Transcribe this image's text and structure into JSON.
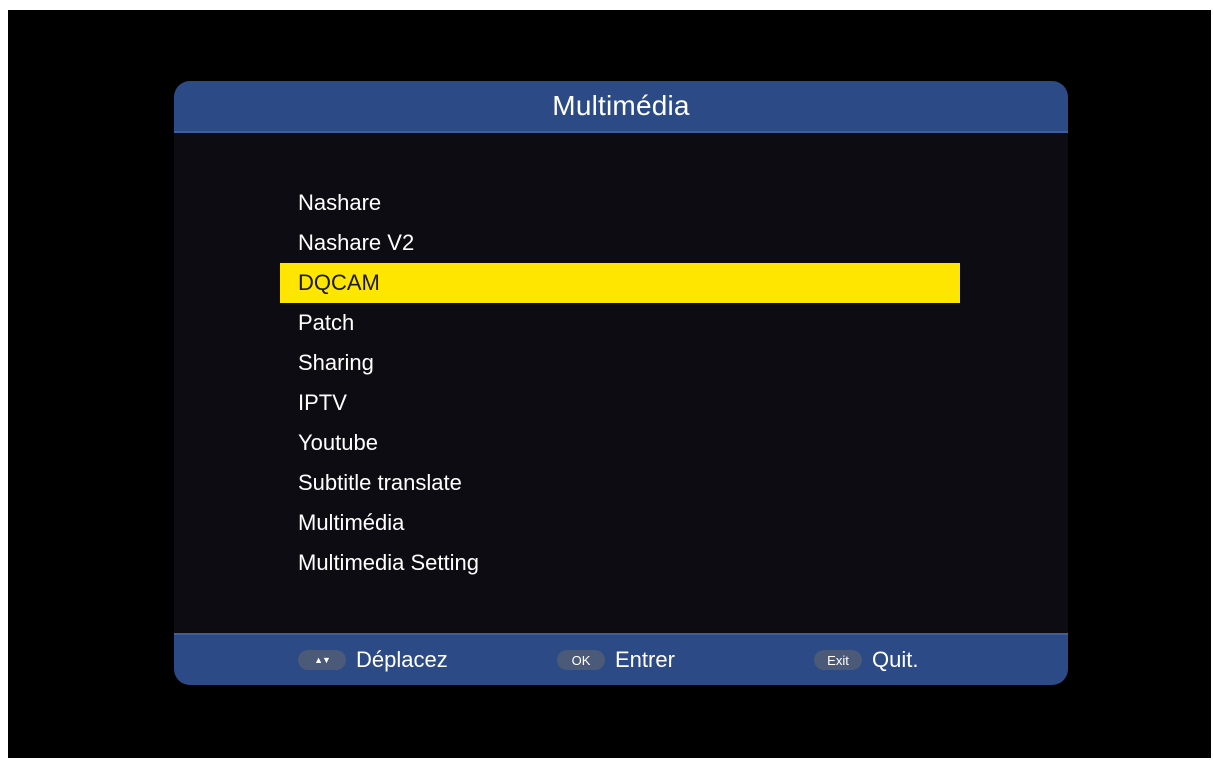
{
  "header": {
    "title": "Multimédia"
  },
  "menu": {
    "selected_index": 2,
    "items": [
      {
        "label": "Nashare"
      },
      {
        "label": "Nashare V2"
      },
      {
        "label": "DQCAM"
      },
      {
        "label": "Patch"
      },
      {
        "label": "Sharing"
      },
      {
        "label": "IPTV"
      },
      {
        "label": "Youtube"
      },
      {
        "label": "Subtitle translate"
      },
      {
        "label": "Multimédia"
      },
      {
        "label": "Multimedia Setting"
      }
    ]
  },
  "footer": {
    "move": {
      "key_icon": "up-down-arrows-icon",
      "key_label": "▲▼",
      "label": "Déplacez"
    },
    "ok": {
      "key_label": "OK",
      "label": "Entrer"
    },
    "exit": {
      "key_label": "Exit",
      "label": "Quit."
    }
  },
  "colors": {
    "screen_background": "#000000",
    "panel_background": "#0c0c12",
    "bar_blue": "#2c4a86",
    "selection_yellow": "#ffe600",
    "key_pill": "#4a5a78",
    "text": "#ffffff"
  }
}
